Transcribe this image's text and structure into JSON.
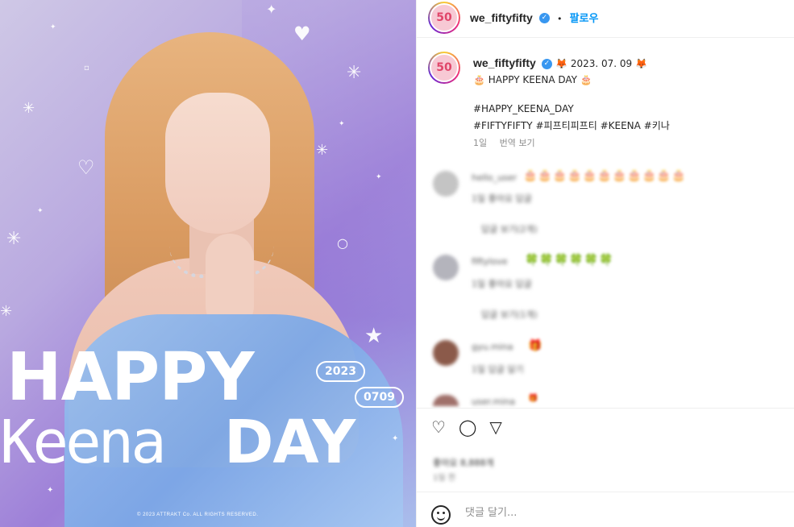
{
  "post_image": {
    "headline_top": "HAPPY",
    "headline_name": "Keena",
    "headline_day": "DAY",
    "year_badge": "2023",
    "date_badge": "0709",
    "copyright": "© 2023 ATTRAKT Co. ALL RIGHTS RESERVED."
  },
  "header": {
    "avatar_initials": "50",
    "username": "we_fiftyfifty",
    "separator": "•",
    "follow_label": "팔로우"
  },
  "caption": {
    "username": "we_fiftyfifty",
    "date_line": "🦊 2023. 07. 09 🦊",
    "line1": "🎂 HAPPY KEENA DAY 🎂",
    "line2": "#HAPPY_KEENA_DAY",
    "line3": "#FIFTYFIFTY #피프티피프티 #KEENA #키나",
    "time_ago": "1일",
    "translate_label": "번역 보기"
  },
  "comments": [
    {
      "name": "hello_user",
      "emojis": "🎂🎂🎂🎂🎂🎂🎂🎂🎂🎂🎂",
      "meta": "1일 좋아요 답글",
      "replies": "답글 보기(2개)",
      "avatar_color": "#bfbfbf"
    },
    {
      "name": "fiftylove",
      "emojis": "🍀🍀🍀🍀🍀🍀",
      "meta": "1일 좋아요 답글",
      "replies": "답글 보기(1개)",
      "avatar_color": "#a9a9b0"
    },
    {
      "name": "gyu.mina",
      "emojis": "🎁",
      "meta": "1일 답글 달기",
      "replies": "",
      "avatar_color": "#8b5a4a"
    },
    {
      "name": "user.mina",
      "emojis": "🎁",
      "meta": "",
      "replies": "",
      "avatar_color": "#a0706a"
    }
  ],
  "actions": {
    "like_icon": "heart-icon",
    "comment_icon": "comment-icon",
    "share_icon": "share-icon"
  },
  "likes_text": "좋아요 8,888개",
  "date_text": "1일 전",
  "comment_box": {
    "placeholder": "댓글 달기..."
  }
}
